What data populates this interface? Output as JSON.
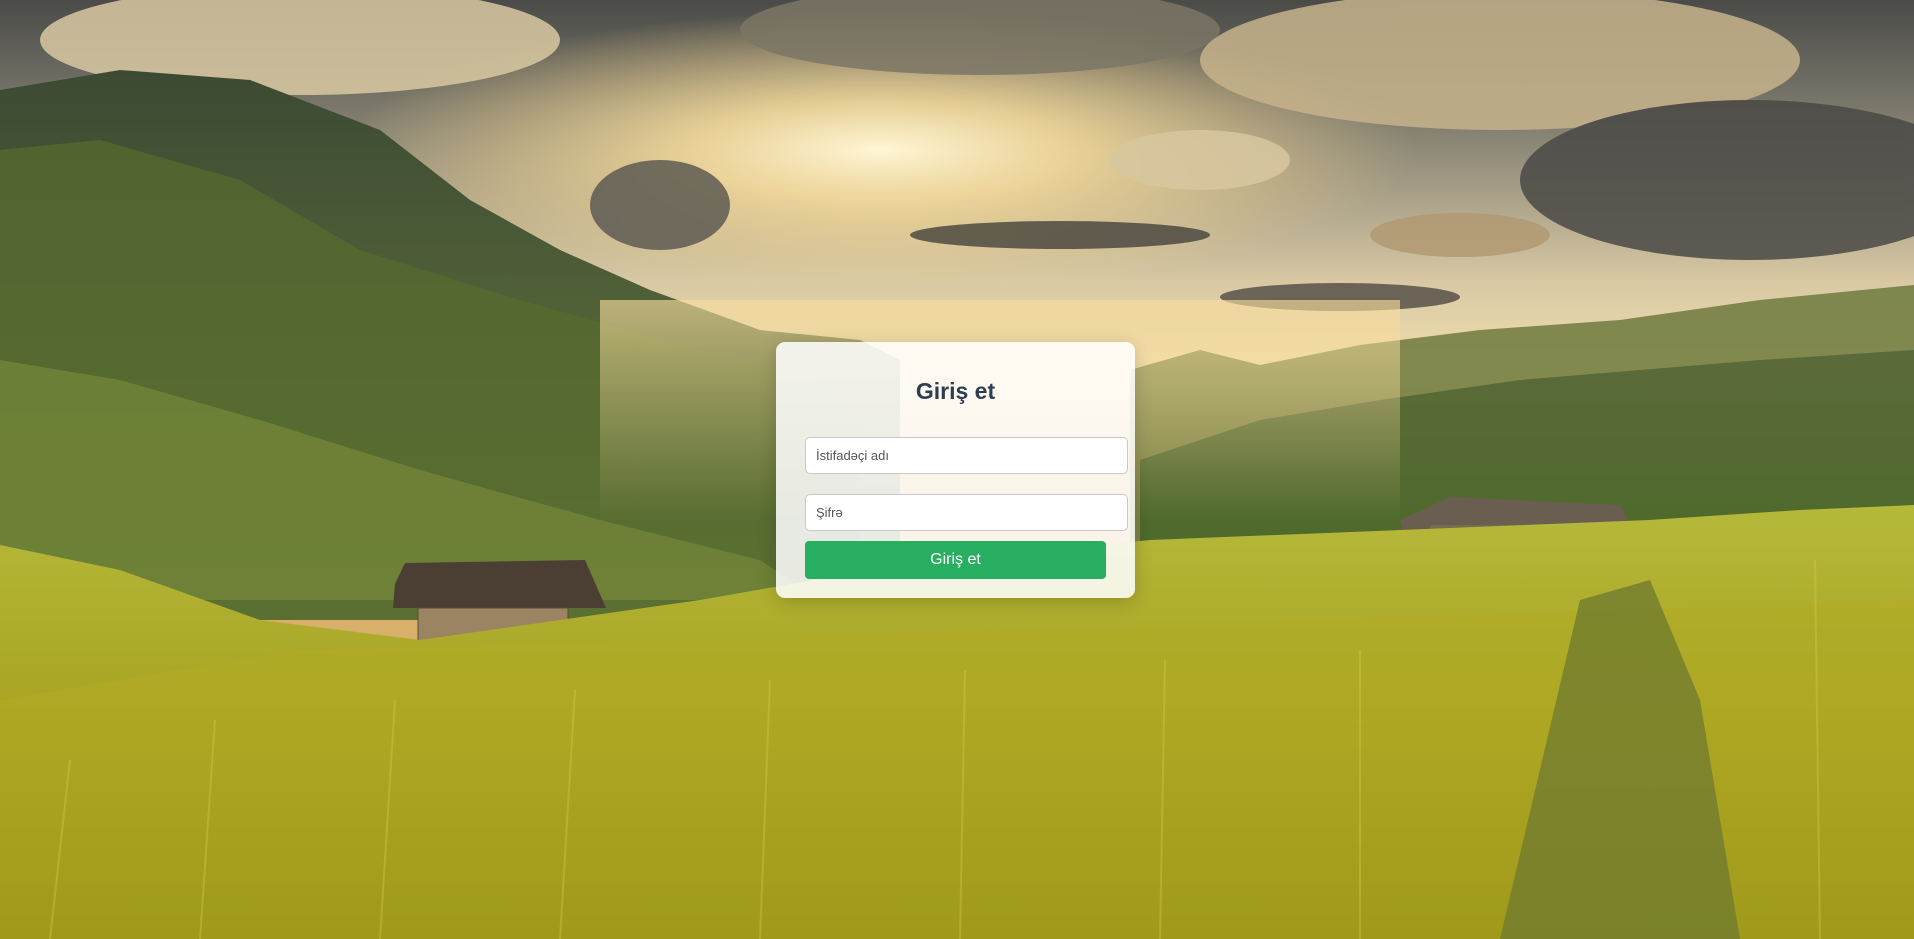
{
  "login": {
    "title": "Giriş et",
    "username_placeholder": "İstifadəçi adı",
    "password_placeholder": "Şifrə",
    "submit_label": "Giriş et"
  },
  "colors": {
    "accent": "#27ae60",
    "title": "#2c3e50",
    "card_background": "rgba(255,255,255,0.86)"
  }
}
